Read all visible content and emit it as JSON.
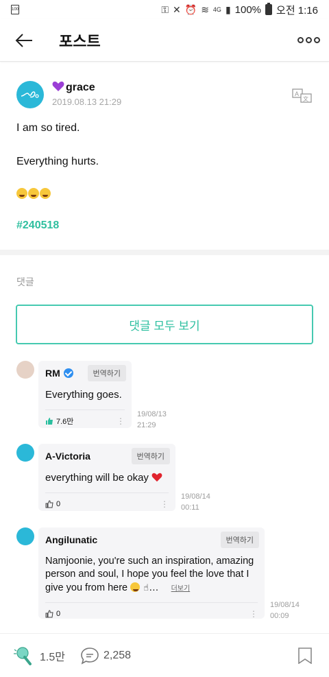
{
  "status_bar": {
    "battery_badge": "100",
    "battery_percent": "100%",
    "time": "오전 1:16",
    "network": "4G"
  },
  "header": {
    "title": "포스트"
  },
  "post": {
    "author": "grace",
    "date": "2019.08.13 21:29",
    "line1": "I am so tired.",
    "line2": "Everything hurts.",
    "hashtag": "#240518"
  },
  "comments_section": {
    "label": "댓글",
    "view_all": "댓글 모두 보기",
    "translate_label": "번역하기",
    "more_label": "더보기",
    "items": [
      {
        "name": "RM",
        "verified": true,
        "text": "Everything goes.",
        "likes": "7.6만",
        "date": "19/08/13",
        "time": "21:29"
      },
      {
        "name": "A-Victoria",
        "verified": false,
        "text": "everything will be okay",
        "likes": "0",
        "date": "19/08/14",
        "time": "00:11"
      },
      {
        "name": "Angilunatic",
        "verified": false,
        "text": "Namjoonie, you're such an inspiration, amazing person and soul, I hope you feel the love that I give you from here",
        "likes": "0",
        "date": "19/08/14",
        "time": "00:09"
      }
    ]
  },
  "bottom_bar": {
    "likes": "1.5만",
    "comments": "2,258"
  },
  "colors": {
    "accent": "#2bbf9f",
    "avatar": "#2bb8d8",
    "verified": "#2f8ff0"
  }
}
